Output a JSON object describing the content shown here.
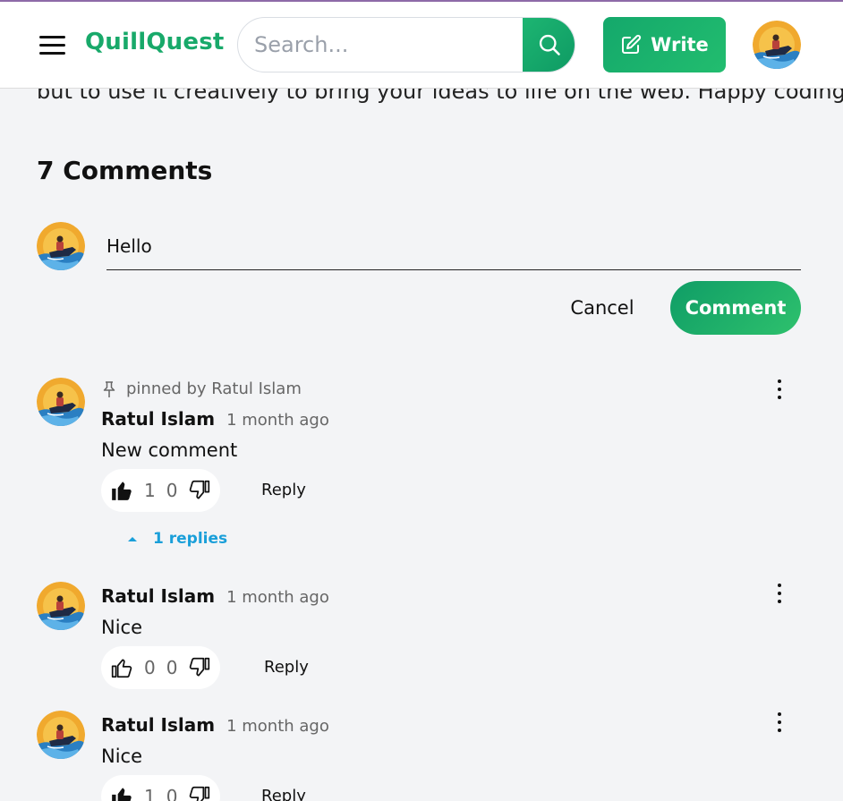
{
  "header": {
    "logo": "QuillQuest",
    "search_placeholder": "Search...",
    "write_label": "Write"
  },
  "article": {
    "tail_text": "but to use it creatively to bring your ideas to life on the web. Happy coding!"
  },
  "comments_section": {
    "title": "7 Comments",
    "compose": {
      "value": "Hello",
      "cancel_label": "Cancel",
      "submit_label": "Comment"
    },
    "items": [
      {
        "pinned_text": "pinned by Ratul Islam",
        "author": "Ratul Islam",
        "time": "1 month ago",
        "text": "New comment",
        "likes": "1",
        "dislikes": "0",
        "liked": true,
        "reply_label": "Reply",
        "replies_label": "1 replies"
      },
      {
        "author": "Ratul Islam",
        "time": "1 month ago",
        "text": "Nice",
        "likes": "0",
        "dislikes": "0",
        "liked": false,
        "reply_label": "Reply"
      },
      {
        "author": "Ratul Islam",
        "time": "1 month ago",
        "text": "Nice",
        "likes": "1",
        "dislikes": "0",
        "liked": true,
        "reply_label": "Reply"
      }
    ]
  },
  "colors": {
    "brand_green": "#18a96a",
    "link_blue": "#1a9fd9"
  }
}
